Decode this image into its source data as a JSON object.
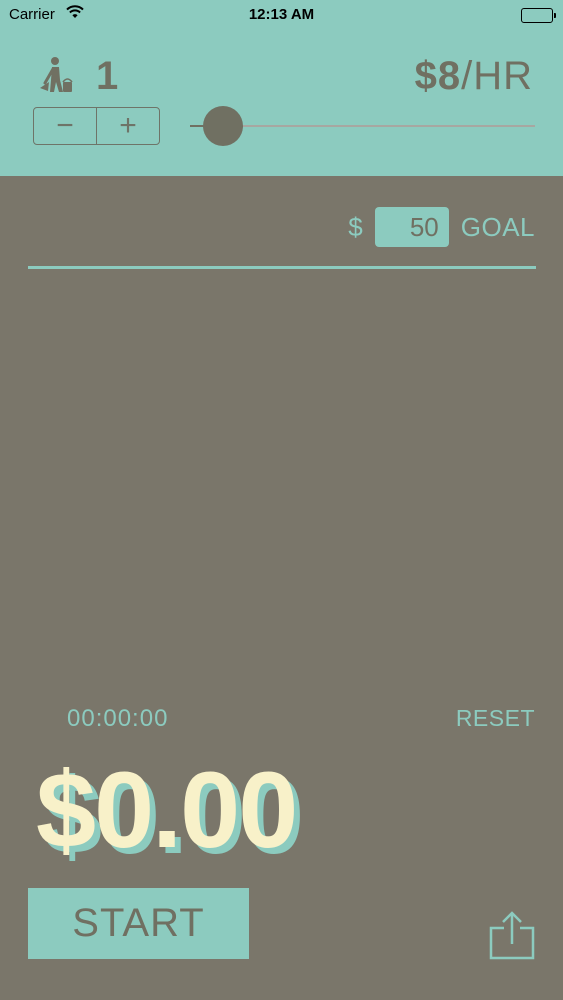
{
  "status_bar": {
    "carrier": "Carrier",
    "time": "12:13 AM",
    "wifi_icon": "wifi-icon",
    "battery_icon": "battery-icon",
    "battery_level": 1.0
  },
  "header": {
    "worker_icon": "worker-icon",
    "worker_count": "1",
    "rate_amount": "$8",
    "rate_unit": "/HR",
    "stepper": {
      "minus": "−",
      "plus": "+"
    },
    "rate_slider_value": 0.06
  },
  "goal": {
    "currency": "$",
    "value": "50",
    "label": "GOAL"
  },
  "timer": "00:00:00",
  "reset_label": "RESET",
  "earnings": "$0.00",
  "start_label": "START",
  "share_icon": "share-icon",
  "colors": {
    "accent": "#8ccbbf",
    "background": "#7a766a",
    "text_dark": "#707062",
    "earnings": "#f8f1c9"
  }
}
